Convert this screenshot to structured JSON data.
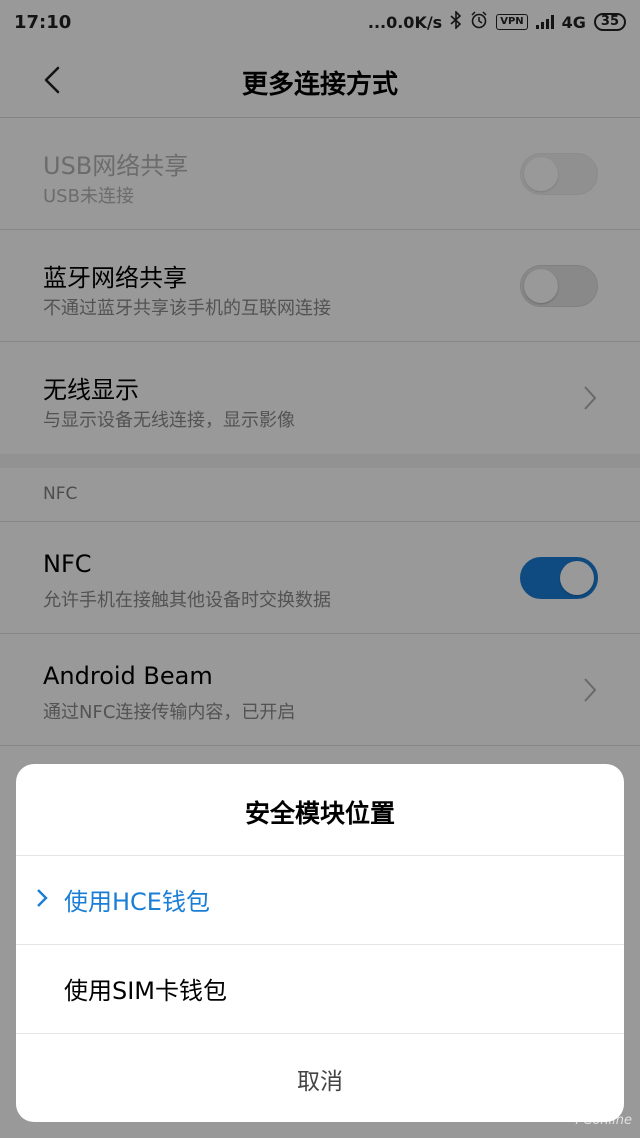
{
  "status_bar": {
    "time": "17:10",
    "network_speed": "...0.0K/s",
    "vpn": "VPN",
    "network_type": "4G",
    "battery": "35"
  },
  "header": {
    "title": "更多连接方式"
  },
  "items": {
    "usb": {
      "title": "USB网络共享",
      "subtitle": "USB未连接",
      "enabled": false,
      "toggle_on": false
    },
    "bt": {
      "title": "蓝牙网络共享",
      "subtitle": "不通过蓝牙共享该手机的互联网连接",
      "toggle_on": false
    },
    "wireless_display": {
      "title": "无线显示",
      "subtitle": "与显示设备无线连接，显示影像"
    },
    "nfc_section": "NFC",
    "nfc": {
      "title": "NFC",
      "subtitle": "允许手机在接触其他设备时交换数据",
      "toggle_on": true
    },
    "android_beam": {
      "title": "Android Beam",
      "subtitle": "通过NFC连接传输内容，已开启"
    }
  },
  "dialog": {
    "title": "安全模块位置",
    "options": [
      {
        "label": "使用HCE钱包",
        "selected": true
      },
      {
        "label": "使用SIM卡钱包",
        "selected": false
      }
    ],
    "cancel": "取消"
  },
  "colors": {
    "accent": "#1a7ed6",
    "overlay": "rgba(0,0,0,0.40)"
  },
  "watermark": "PConline"
}
